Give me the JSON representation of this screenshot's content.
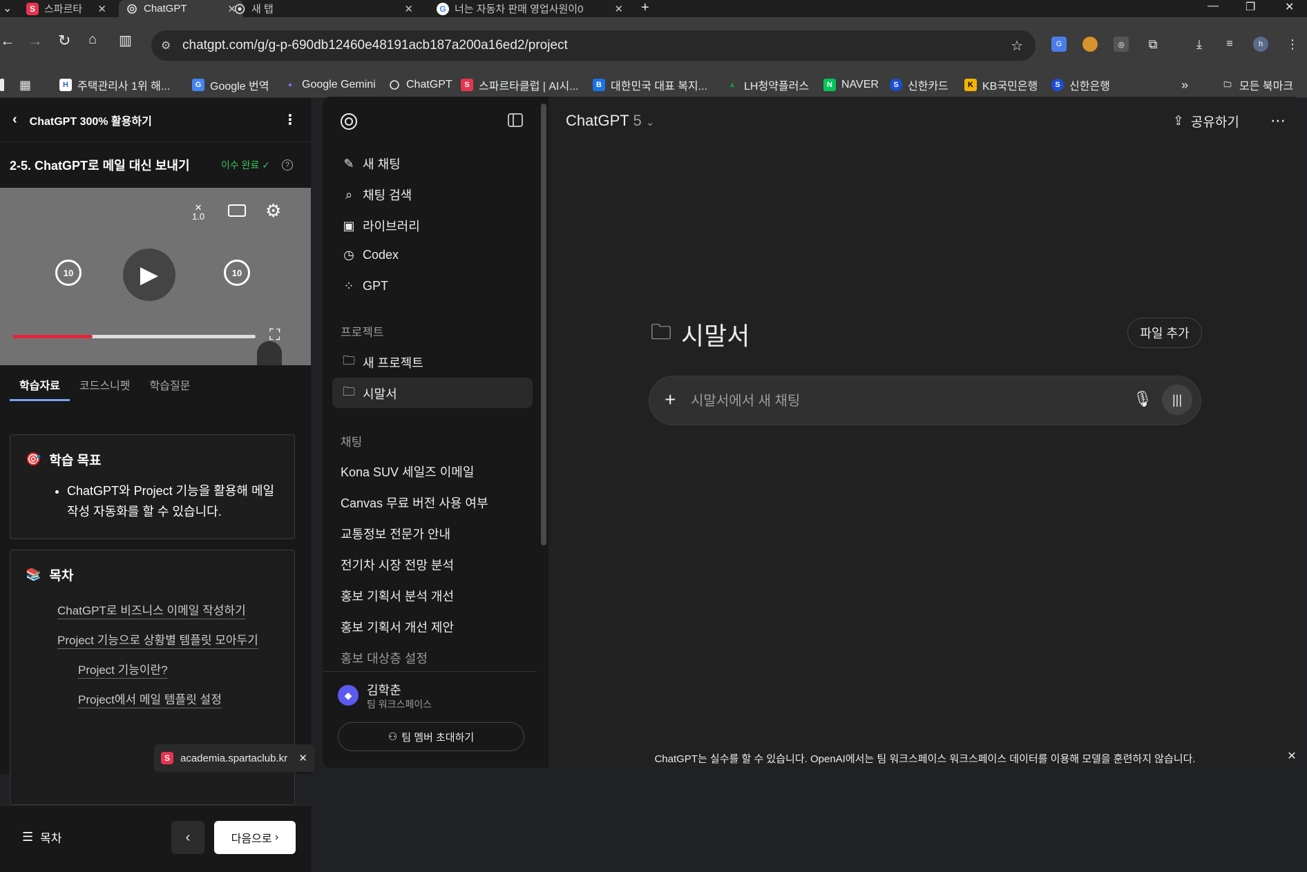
{
  "browser": {
    "tabs": [
      {
        "title": "스파르타",
        "favicon": "S",
        "color": "#e8344e"
      },
      {
        "title": "ChatGPT",
        "favicon": "openai-logo",
        "color": "#ffffff"
      },
      {
        "title": "새 탭",
        "favicon": "chrome-logo",
        "color": "#ffffff"
      },
      {
        "title": "너는 자동차 판매 영업사원이0",
        "favicon": "G",
        "color": "#4285f4"
      }
    ],
    "new_tab_symbol": "+",
    "url": "chatgpt.com/g/g-p-690db12460e48191acb187a200a16ed2/project",
    "profile_initial": "h",
    "bookmarks": [
      {
        "label": "주택관리사 1위 해...",
        "icon": "H",
        "color": "#2f5fce"
      },
      {
        "label": "Google 번역",
        "icon": "G",
        "color": "#4285f4"
      },
      {
        "label": "Google Gemini",
        "icon": "✦",
        "color": "#8a6cf0"
      },
      {
        "label": "ChatGPT",
        "icon": "openai-logo",
        "color": "#ffffff"
      },
      {
        "label": "스파르타클럽 | AI시...",
        "icon": "S",
        "color": "#e8344e"
      },
      {
        "label": "대한민국 대표 복지...",
        "icon": "B",
        "color": "#1a73e8"
      },
      {
        "label": "LH청약플러스",
        "icon": "L",
        "color": "#0d9a4a"
      },
      {
        "label": "NAVER",
        "icon": "N",
        "color": "#03c75a"
      },
      {
        "label": "신한카드",
        "icon": "S",
        "color": "#1c4fd8"
      },
      {
        "label": "KB국민은행",
        "icon": "K",
        "color": "#f4b400"
      },
      {
        "label": "신한은행",
        "icon": "S",
        "color": "#1c4fd8"
      }
    ],
    "all_bookmarks_label": "모든 북마크"
  },
  "course": {
    "header_title": "ChatGPT 300% 활용하기",
    "lesson_title": "2-5. ChatGPT로 메일 대신 보내기",
    "completion_label": "이수 완료",
    "video": {
      "speed_label": "1.0",
      "rewind_label": "10",
      "forward_label": "10",
      "progress_fraction": 0.33
    },
    "tabs": [
      "학습자료",
      "코드스니펫",
      "학습질문"
    ],
    "goal": {
      "title": "학습 목표",
      "items": [
        "ChatGPT와 Project 기능을 활용해 메일 작성 자동화를 할 수 있습니다."
      ]
    },
    "toc": {
      "title": "목차",
      "items": [
        "ChatGPT로 비즈니스 이메일 작성하기",
        "Project 기능으로 상황별 템플릿 모아두기",
        "Project 기능이란?",
        "Project에서 메일 템플릿 설정"
      ]
    },
    "footer": {
      "toc_label": "목차",
      "next_label": "다음으로"
    },
    "notice_domain": "academia.spartaclub.kr"
  },
  "sidebar": {
    "nav": [
      {
        "label": "새 채팅",
        "icon": "edit-icon"
      },
      {
        "label": "채팅 검색",
        "icon": "search-icon"
      },
      {
        "label": "라이브러리",
        "icon": "library-icon"
      },
      {
        "label": "Codex",
        "icon": "codex-icon"
      },
      {
        "label": "GPT",
        "icon": "gpt-grid-icon"
      }
    ],
    "projects_heading": "프로젝트",
    "new_project_label": "새 프로젝트",
    "project_label": "시말서",
    "chats_heading": "채팅",
    "chats": [
      "Kona SUV 세일즈 이메일",
      "Canvas 무료 버전 사용 여부",
      "교통정보 전문가 안내",
      "전기차 시장 전망 분석",
      "홍보 기획서 분석 개선",
      "홍보 기획서 개선 제안",
      "홍보 대상층 설정"
    ],
    "user_name": "김학춘",
    "workspace_label": "팀 워크스페이스",
    "invite_label": "팀 멤버 초대하기"
  },
  "main": {
    "model_name": "ChatGPT",
    "model_version": "5",
    "share_label": "공유하기",
    "project_title": "시말서",
    "add_file_label": "파일 추가",
    "composer_placeholder": "시말서에서 새 채팅",
    "footnote": "ChatGPT는 실수를 할 수 있습니다. OpenAI에서는 팀 워크스페이스 워크스페이스 데이터를 이용해 모델을 훈련하지 않습니다."
  },
  "colors": {
    "accent_blue": "#7da1ff",
    "progress_red": "#e3263b",
    "complete_green": "#35c25c"
  }
}
